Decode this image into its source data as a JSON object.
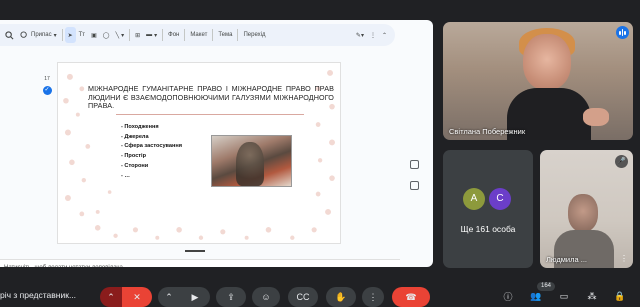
{
  "toolbar": {
    "search_label": "Q",
    "insert_label": "Припас",
    "tt_label": "Тт",
    "bg_label": "Фон",
    "layout_label": "Макет",
    "theme_label": "Тема",
    "transition_label": "Перехід"
  },
  "slide_panel": {
    "slide_number": "17"
  },
  "slide": {
    "title": "МІЖНАРОДНЕ ГУМАНІТАРНЕ ПРАВО І МІЖНАРОДНЕ ПРАВО ПРАВ ЛЮДИНИ Є ВЗАЄМОДОПОВНЮЮЧИМИ ГАЛУЗЯМИ МІЖНАРОДНОГО ПРАВА.",
    "bullets": [
      "- Походження",
      "- Джерела",
      "- Сфера застосування",
      "- Простір",
      "- Сторони",
      "- …"
    ]
  },
  "notes": {
    "placeholder": "Натисніть, щоб додати нотатки доповідача"
  },
  "participants": {
    "main": {
      "name": "Світлана Побережник"
    },
    "group": {
      "avatar_a": "A",
      "avatar_c": "C",
      "label": "Ще 161 особа"
    },
    "cam": {
      "name": "Людмила ..."
    }
  },
  "bottom": {
    "meeting_title": "річ з представник...",
    "participants_count": "164"
  },
  "colors": {
    "accent": "#1a73e8",
    "danger": "#ea4335",
    "bg": "#202124"
  }
}
